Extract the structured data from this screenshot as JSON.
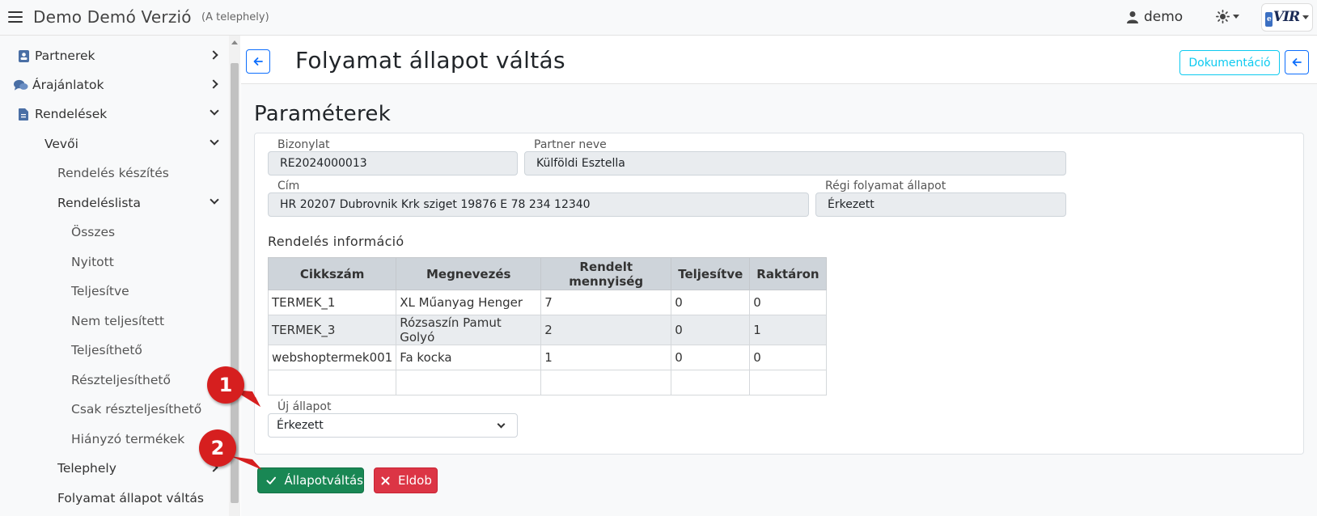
{
  "topbar": {
    "title": "Demo Demó Verzió",
    "site": "(A telephely)",
    "user": "demo",
    "logo_text": "VIR",
    "logo_e": "e"
  },
  "sidebar": {
    "partnerek": "Partnerek",
    "arajanlatok": "Árajánlatok",
    "rendelesek": "Rendelések",
    "vevoi": "Vevői",
    "rendeles_keszites": "Rendelés készítés",
    "rendeleslista": "Rendeléslista",
    "osszes": "Összes",
    "nyitott": "Nyitott",
    "teljesitve": "Teljesítve",
    "nem_teljesitett": "Nem teljesített",
    "teljesitheto": "Teljesíthető",
    "reszteljesitheto": "Részteljesíthető",
    "csak_reszteljesitheto": "Csak részteljesíthető",
    "hianyzo_termekek": "Hiányzó termékek",
    "telephely": "Telephely",
    "folyamat_cut": "Folyamat állapot váltás"
  },
  "header": {
    "title": "Folyamat állapot váltás",
    "doc_button": "Dokumentáció"
  },
  "params": {
    "section_title": "Paraméterek",
    "bizonylat_label": "Bizonylat",
    "bizonylat_value": "RE2024000013",
    "partner_label": "Partner neve",
    "partner_value": "Külföldi Esztella",
    "cim_label": "Cím",
    "cim_value": "HR 20207 Dubrovnik Krk sziget 19876 E 78 234 12340",
    "regi_label": "Régi folyamat állapot",
    "regi_value": "Érkezett",
    "info_title": "Rendelés információ",
    "uj_label": "Új állapot",
    "uj_value": "Érkezett"
  },
  "table": {
    "headers": [
      "Cikkszám",
      "Megnevezés",
      "Rendelt mennyiség",
      "Teljesítve",
      "Raktáron"
    ],
    "rows": [
      [
        "TERMEK_1",
        "XL Műanyag Henger",
        "7",
        "0",
        "0"
      ],
      [
        "TERMEK_3",
        "Rózsaszín Pamut Golyó",
        "2",
        "0",
        "1"
      ],
      [
        "webshoptermek001",
        "Fa kocka",
        "1",
        "0",
        "0"
      ]
    ]
  },
  "actions": {
    "submit": "Állapotváltás",
    "discard": "Eldob"
  },
  "badges": [
    "1",
    "2"
  ],
  "colors": {
    "primary": "#0d6efd",
    "info": "#0dcaf0",
    "success": "#198754",
    "danger": "#dc3545",
    "badge": "#d61f1f"
  }
}
